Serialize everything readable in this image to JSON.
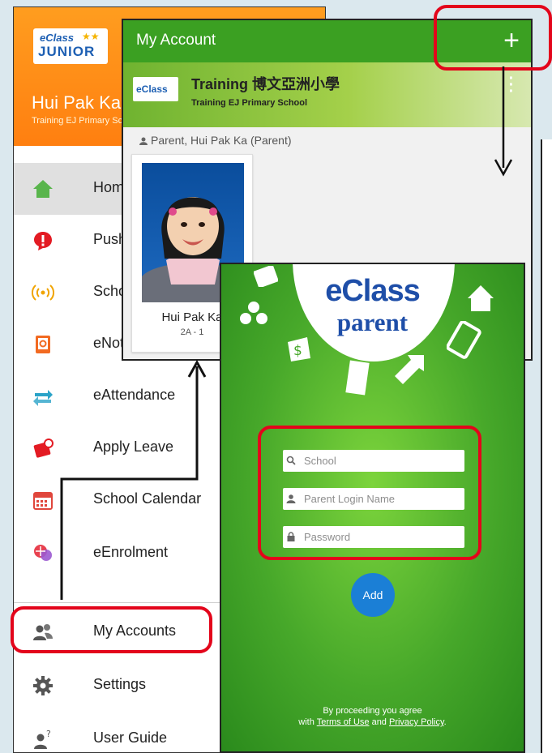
{
  "drawer": {
    "user_name": "Hui Pak Ka",
    "school": "Training EJ Primary School",
    "logo_text_top": "eClass",
    "logo_text_bottom": "JUNIOR",
    "items": [
      {
        "label": "Home",
        "icon": "home-icon"
      },
      {
        "label": "Push Message",
        "icon": "alert-icon"
      },
      {
        "label": "School News",
        "icon": "broadcast-icon"
      },
      {
        "label": "eNotice",
        "icon": "notice-icon"
      },
      {
        "label": "eAttendance",
        "icon": "swap-arrows-icon"
      },
      {
        "label": "Apply Leave",
        "icon": "leave-icon"
      },
      {
        "label": "School Calendar",
        "icon": "calendar-icon"
      },
      {
        "label": "eEnrolment",
        "icon": "enrolment-icon"
      },
      {
        "label": "My Accounts",
        "icon": "accounts-icon"
      },
      {
        "label": "Settings",
        "icon": "gear-icon"
      },
      {
        "label": "User Guide",
        "icon": "help-user-icon"
      }
    ]
  },
  "account": {
    "title": "My Account",
    "add_symbol": "+",
    "school_cn": "Training 博文亞洲小學",
    "school_en": "Training EJ Primary School",
    "banner_logo": "eClass",
    "role_line": "Parent, Hui Pak Ka (Parent)",
    "child_name": "Hui Pak Ka",
    "child_class": "2A - 1"
  },
  "login": {
    "brand_top": "eClass",
    "brand_bottom": "parent",
    "school_placeholder": "School",
    "login_placeholder": "Parent Login Name",
    "password_placeholder": "Password",
    "add_label": "Add",
    "terms_line1": "By proceeding you agree",
    "terms_with": "with ",
    "terms_of_use": "Terms of Use",
    "terms_and": " and ",
    "privacy_policy": "Privacy Policy",
    "terms_end": "."
  },
  "colors": {
    "highlight": "#e3051b",
    "account_green": "#3ba022",
    "drawer_orange": "#ff8a15",
    "add_button_blue": "#1b7fd6"
  }
}
